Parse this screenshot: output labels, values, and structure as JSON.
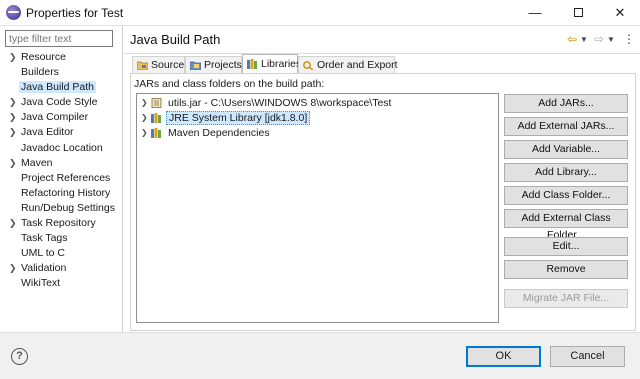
{
  "window": {
    "title": "Properties for Test",
    "minimize": "—",
    "close": "✕"
  },
  "filter": {
    "placeholder": "type filter text"
  },
  "nav_tree": [
    {
      "label": "Resource",
      "expandable": true,
      "selected": false
    },
    {
      "label": "Builders",
      "expandable": false,
      "selected": false
    },
    {
      "label": "Java Build Path",
      "expandable": false,
      "selected": true
    },
    {
      "label": "Java Code Style",
      "expandable": true,
      "selected": false
    },
    {
      "label": "Java Compiler",
      "expandable": true,
      "selected": false
    },
    {
      "label": "Java Editor",
      "expandable": true,
      "selected": false
    },
    {
      "label": "Javadoc Location",
      "expandable": false,
      "selected": false
    },
    {
      "label": "Maven",
      "expandable": true,
      "selected": false
    },
    {
      "label": "Project References",
      "expandable": false,
      "selected": false
    },
    {
      "label": "Refactoring History",
      "expandable": false,
      "selected": false
    },
    {
      "label": "Run/Debug Settings",
      "expandable": false,
      "selected": false
    },
    {
      "label": "Task Repository",
      "expandable": true,
      "selected": false
    },
    {
      "label": "Task Tags",
      "expandable": false,
      "selected": false
    },
    {
      "label": "UML to C",
      "expandable": false,
      "selected": false
    },
    {
      "label": "Validation",
      "expandable": true,
      "selected": false
    },
    {
      "label": "WikiText",
      "expandable": false,
      "selected": false
    }
  ],
  "page": {
    "title": "Java Build Path"
  },
  "tabs": [
    {
      "label": "Source",
      "active": false,
      "icon": "source-folder-icon"
    },
    {
      "label": "Projects",
      "active": false,
      "icon": "projects-icon"
    },
    {
      "label": "Libraries",
      "active": true,
      "icon": "libraries-icon"
    },
    {
      "label": "Order and Export",
      "active": false,
      "icon": "order-export-icon"
    }
  ],
  "libraries": {
    "description": "JARs and class folders on the build path:",
    "items": [
      {
        "label": "utils.jar - C:\\Users\\WINDOWS 8\\workspace\\Test",
        "icon": "jar-icon",
        "selected": false
      },
      {
        "label": "JRE System Library [jdk1.8.0]",
        "icon": "library-icon",
        "selected": true
      },
      {
        "label": "Maven Dependencies",
        "icon": "library-icon",
        "selected": false
      }
    ]
  },
  "buttons": {
    "add_jars": "Add JARs...",
    "add_external_jars": "Add External JARs...",
    "add_variable": "Add Variable...",
    "add_library": "Add Library...",
    "add_class_folder": "Add Class Folder...",
    "add_external_class_folder": "Add External Class Folder...",
    "edit": "Edit...",
    "remove": "Remove",
    "migrate_jar": "Migrate JAR File..."
  },
  "footer": {
    "help": "?",
    "ok": "OK",
    "cancel": "Cancel"
  }
}
